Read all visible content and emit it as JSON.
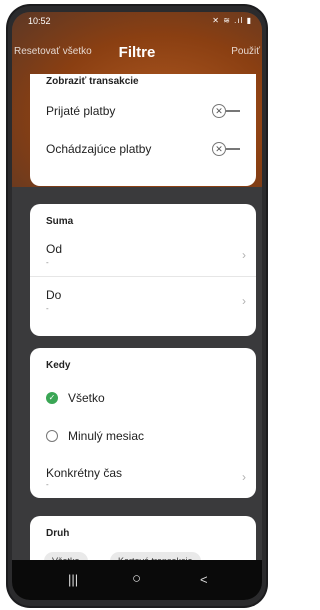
{
  "status": {
    "time": "10:52",
    "icons": "✕ ≋ .ıl ▮"
  },
  "header": {
    "reset_label": "Resetovať všetko",
    "title": "Filtre",
    "apply_label": "Použiť"
  },
  "transactions": {
    "heading": "Zobraziť transakcie",
    "received_label": "Prijaté platby",
    "outgoing_label": "Ochádzajúce platby"
  },
  "amount": {
    "heading": "Suma",
    "from_label": "Od",
    "from_value": "-",
    "to_label": "Do",
    "to_value": "-"
  },
  "when": {
    "heading": "Kedy",
    "options": [
      {
        "label": "Všetko",
        "checked": true
      },
      {
        "label": "Minulý mesiac",
        "checked": false
      }
    ],
    "specific_label": "Konkrétny čas",
    "specific_value": "-"
  },
  "type": {
    "heading": "Druh",
    "chips": [
      "Všetko",
      "Kartové transakcie"
    ]
  },
  "navbar": {
    "recent_icon": "|||",
    "home_icon": "○",
    "back_icon": "<"
  },
  "colors": {
    "accent_orange": "#8a3f12",
    "radio_green": "#3aa655"
  }
}
